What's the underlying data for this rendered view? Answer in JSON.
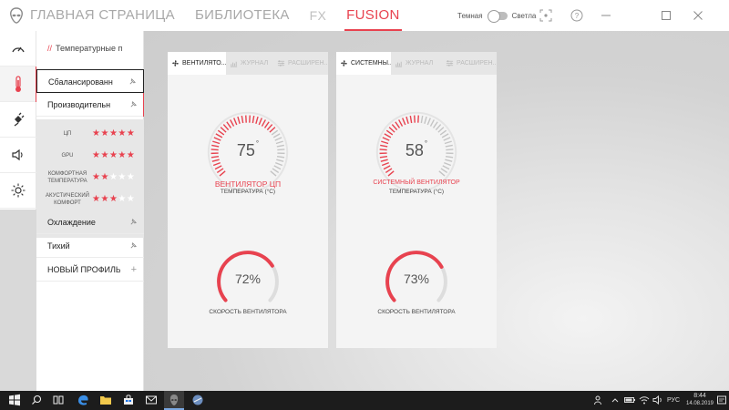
{
  "nav": {
    "items": [
      "ГЛАВНАЯ СТРАНИЦА",
      "БИБЛИОТЕКА",
      "FX",
      "FUSION"
    ],
    "active": "FUSION"
  },
  "theme": {
    "dark_label": "Темная",
    "light_label": "Светла"
  },
  "panel": {
    "title": "Температурные п",
    "profiles": {
      "balanced": "Сбалансированн",
      "performance": "Производительн",
      "cooling": "Охлаждение",
      "quiet": "Тихий",
      "new_profile": "НОВЫЙ ПРОФИЛЬ",
      "plus": "+"
    },
    "ratings": [
      {
        "label": "ЦП",
        "stars": 5,
        "max": 5
      },
      {
        "label": "GPU",
        "stars": 5,
        "max": 5
      },
      {
        "label": "КОМФОРТНАЯ ТЕМПЕРАТУРА",
        "stars": 2,
        "max": 5
      },
      {
        "label": "АКУСТИЧЕСКИЙ КОМФОРТ",
        "stars": 3,
        "max": 5
      }
    ]
  },
  "cards": [
    {
      "tabs": [
        "ВЕНТИЛЯТО...",
        "ЖУРНАЛ",
        "РАСШИРЕН..."
      ],
      "temperature": "75",
      "deg": "°",
      "fan_name": "ВЕНТИЛЯТОР ЦП",
      "temp_label": "ТЕМПЕРАТУРА (°C)",
      "temp_fraction": 0.7,
      "speed": "72%",
      "speed_fraction": 0.72,
      "speed_label": "СКОРОСТЬ ВЕНТИЛЯТОРА"
    },
    {
      "tabs": [
        "СИСТЕМНЫ...",
        "ЖУРНАЛ",
        "РАСШИРЕН..."
      ],
      "temperature": "58",
      "deg": "°",
      "fan_name": "СИСТЕМНЫЙ ВЕНТИЛЯТОР",
      "temp_label": "ТЕМПЕРАТУРА (°C)",
      "temp_fraction": 0.52,
      "speed": "73%",
      "speed_fraction": 0.73,
      "speed_label": "СКОРОСТЬ ВЕНТИЛЯТОРА"
    }
  ],
  "taskbar": {
    "lang": "РУС",
    "time": "8:44",
    "date": "14.08.2019"
  },
  "colors": {
    "accent": "#e8424f",
    "gauge_track": "#dddddd",
    "tick_off": "#c4c4c4"
  },
  "icons": [
    "alien-logo-icon",
    "gauge-icon",
    "thermometer-icon",
    "power-plug-icon",
    "speaker-icon",
    "brightness-icon",
    "crosshair-icon",
    "help-icon",
    "fan-icon",
    "chart-icon",
    "sliders-icon",
    "pin-icon",
    "windows-icon",
    "search-icon",
    "task-view-icon",
    "edge-icon",
    "folder-icon",
    "store-icon",
    "mail-icon",
    "alienware-icon",
    "app-icon",
    "people-icon",
    "chevron-up-icon",
    "battery-icon",
    "wifi-icon",
    "volume-icon",
    "notification-icon"
  ]
}
